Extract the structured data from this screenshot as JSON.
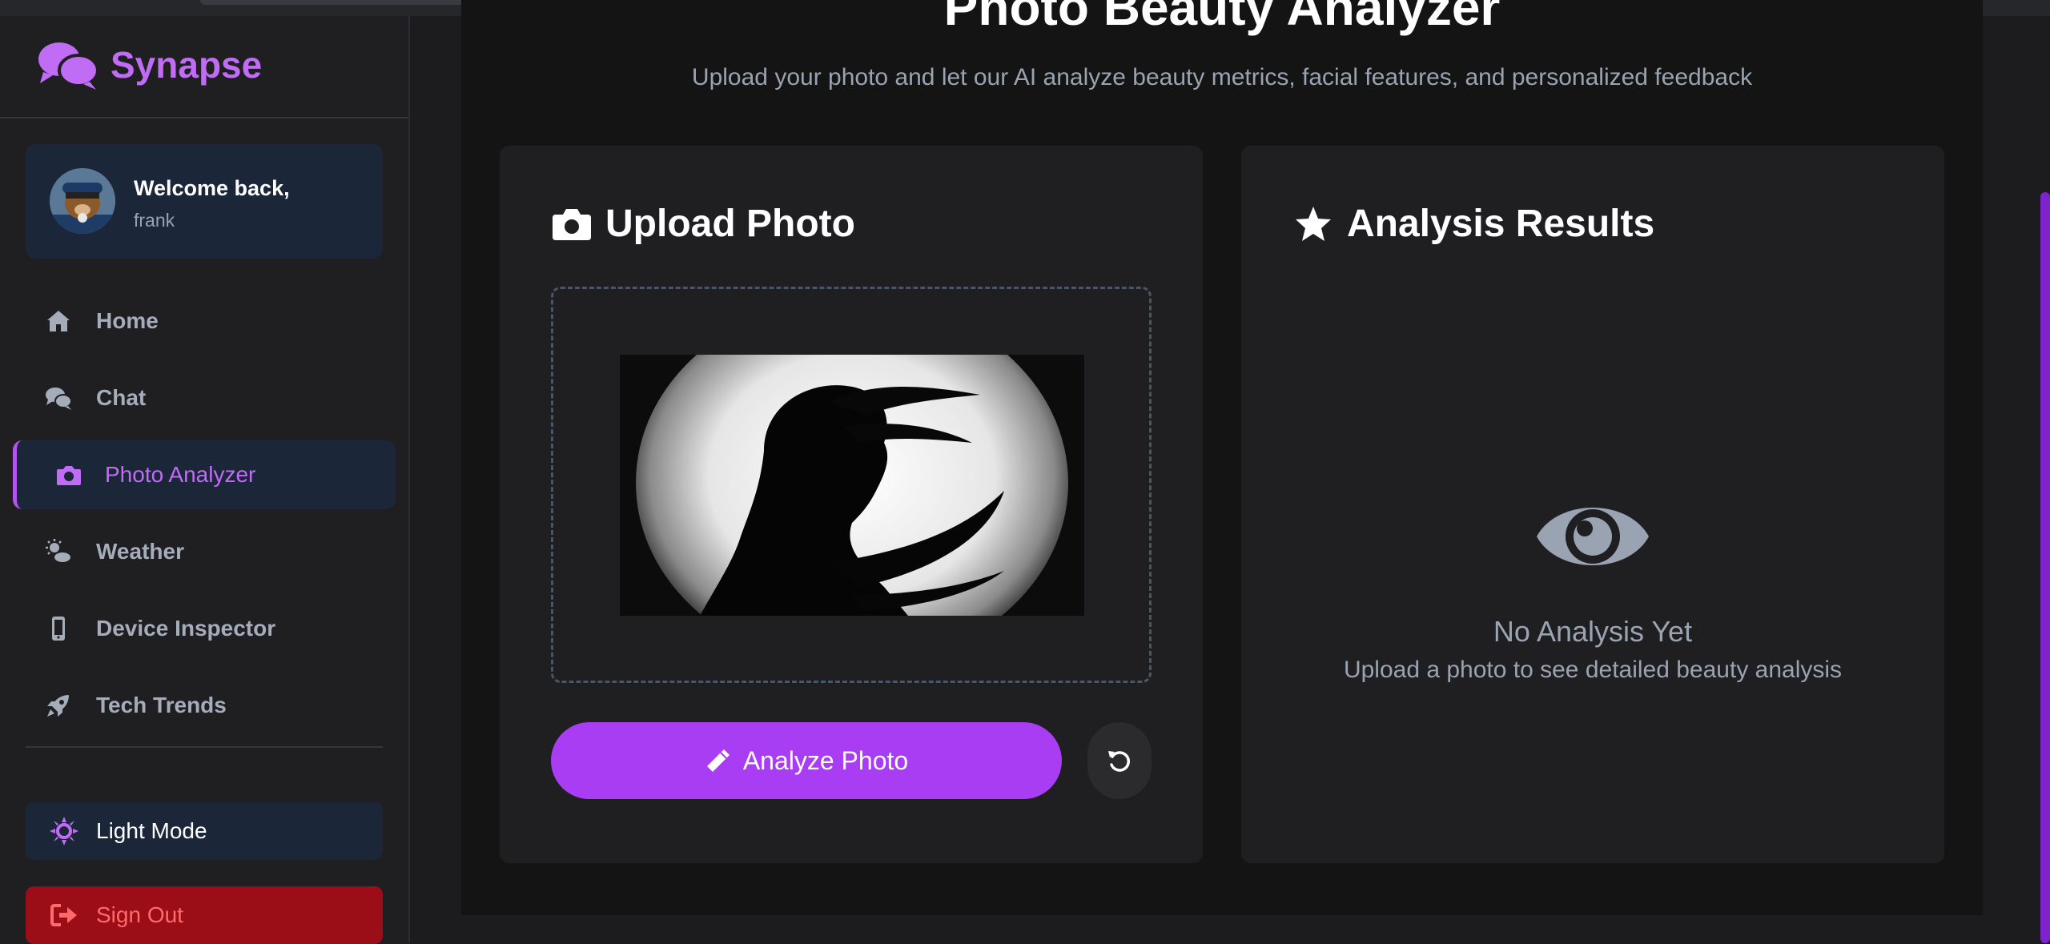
{
  "app": {
    "name": "Synapse"
  },
  "user": {
    "welcome": "Welcome back,",
    "name": "frank"
  },
  "nav": {
    "items": [
      {
        "label": "Home",
        "icon": "home-icon"
      },
      {
        "label": "Chat",
        "icon": "chat-icon"
      },
      {
        "label": "Photo Analyzer",
        "icon": "camera-icon",
        "active": true
      },
      {
        "label": "Weather",
        "icon": "weather-icon"
      },
      {
        "label": "Device Inspector",
        "icon": "mobile-icon"
      },
      {
        "label": "Tech Trends",
        "icon": "rocket-icon"
      }
    ],
    "light_mode": "Light Mode",
    "sign_out": "Sign Out"
  },
  "page": {
    "title": "Photo Beauty Analyzer",
    "subtitle": "Upload your photo and let our AI analyze beauty metrics, facial features, and personalized feedback"
  },
  "upload": {
    "title": "Upload Photo",
    "analyze_label": "Analyze Photo"
  },
  "results": {
    "title": "Analysis Results",
    "empty_heading": "No Analysis Yet",
    "empty_text": "Upload a photo to see detailed beauty analysis"
  },
  "colors": {
    "accent": "#a93df3",
    "brand": "#c06cf5",
    "danger": "#9b0d17",
    "sidebar_card": "#1b2638"
  }
}
